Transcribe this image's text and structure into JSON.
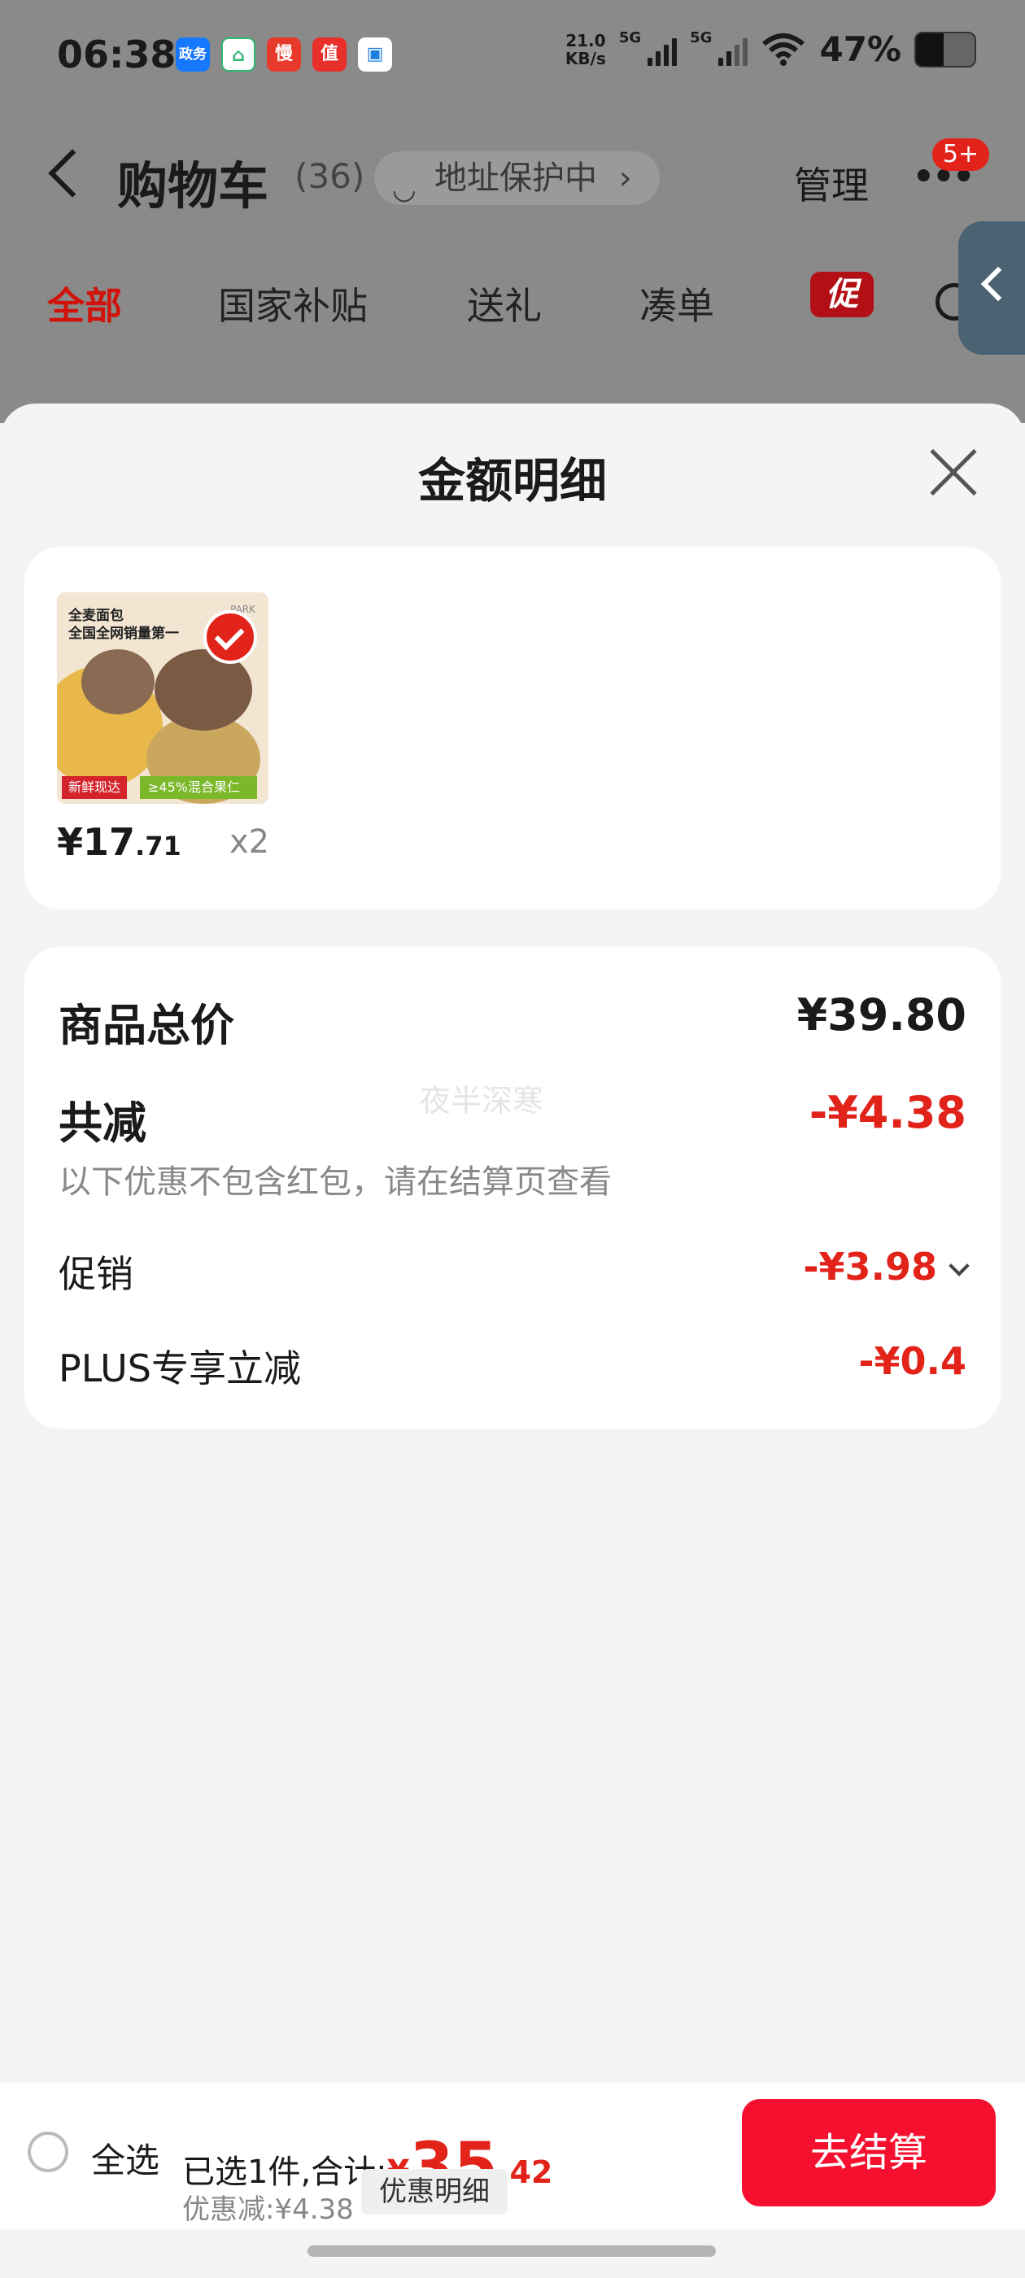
{
  "status_bar": {
    "time": "06:38",
    "apps": [
      {
        "icon": "zhengwu-app-icon",
        "text": "政务",
        "color": "#1677ff"
      },
      {
        "icon": "home-app-icon",
        "text": "⌂",
        "color": "#2eb872"
      },
      {
        "icon": "man-app-icon",
        "text": "慢",
        "color": "#e83a2b"
      },
      {
        "icon": "zhi-app-icon",
        "text": "值",
        "color": "#e8302a"
      },
      {
        "icon": "blue-app-icon",
        "text": "▣",
        "color": "#1d7fe0"
      }
    ],
    "net_speed": "21.0",
    "net_unit": "KB/s",
    "signal1_label": "5G",
    "signal2_label": "5G",
    "battery_percent": "47%",
    "battery_level": 0.47
  },
  "nav": {
    "title": "购物车",
    "count": "(36)",
    "address_protect": "地址保护中",
    "address_chevron": "›",
    "manage": "管理",
    "more": "•••",
    "badge": "5+"
  },
  "tabs": [
    {
      "label": "全部",
      "active": true
    },
    {
      "label": "国家补贴"
    },
    {
      "label": "送礼"
    },
    {
      "label": "凑单"
    }
  ],
  "promo_tag": "促",
  "sheet": {
    "title": "金额明细"
  },
  "product": {
    "thumb_line1": "全麦面包",
    "thumb_line2": "全国全网销量第一",
    "thumb_brand": "PARK",
    "thumb_tag1": "新鲜现达",
    "thumb_tag2": "≥45%混合果仁",
    "price_int": "¥17",
    "price_dec": ".71",
    "qty": "x2"
  },
  "summary": {
    "total_label": "商品总价",
    "total_value": "¥39.80",
    "reduce_label": "共减",
    "reduce_value": "-¥4.38",
    "watermark": "夜半深寒",
    "note": "以下优惠不包含红包，请在结算页查看",
    "promo_label": "促销",
    "promo_value": "-¥3.98",
    "plus_label": "PLUS专享立减",
    "plus_value": "-¥0.4"
  },
  "bottom_bar": {
    "select_all": "全选",
    "selected_prefix": "已选1件,合计:",
    "total_symbol": "¥",
    "total_int": "35",
    "total_dec": ".42",
    "discount": "优惠减:¥4.38",
    "detail_button": "优惠明细",
    "checkout": "去结算"
  }
}
